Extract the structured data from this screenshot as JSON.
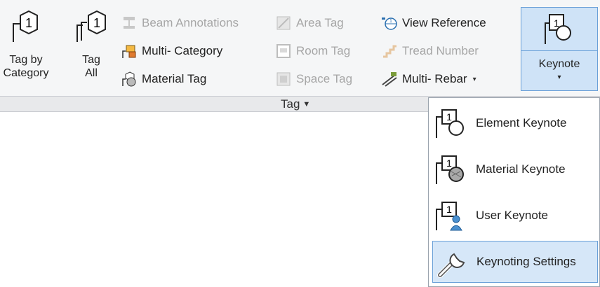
{
  "ribbon": {
    "tag_by_category": {
      "line1": "Tag by",
      "line2": "Category"
    },
    "tag_all": {
      "line1": "Tag",
      "line2": "All"
    },
    "col1": [
      {
        "label": "Beam  Annotations",
        "enabled": false,
        "icon": "beam-annotations-icon"
      },
      {
        "label": "Multi- Category",
        "enabled": true,
        "icon": "multi-category-icon"
      },
      {
        "label": "Material  Tag",
        "enabled": true,
        "icon": "material-tag-icon"
      }
    ],
    "col2": [
      {
        "label": "Area  Tag",
        "enabled": false,
        "icon": "area-tag-icon"
      },
      {
        "label": "Room  Tag",
        "enabled": false,
        "icon": "room-tag-icon"
      },
      {
        "label": "Space  Tag",
        "enabled": false,
        "icon": "space-tag-icon"
      }
    ],
    "col3": [
      {
        "label": "View  Reference",
        "enabled": true,
        "icon": "view-reference-icon"
      },
      {
        "label": "Tread  Number",
        "enabled": false,
        "icon": "tread-number-icon"
      },
      {
        "label": "Multi- Rebar",
        "enabled": true,
        "icon": "multi-rebar-icon",
        "caret": "▾"
      }
    ],
    "keynote": {
      "label": "Keynote",
      "caret": "▾"
    },
    "panel_title": "Tag",
    "panel_caret": "▼"
  },
  "keynote_menu": {
    "items": [
      {
        "label": "Element Keynote",
        "icon": "element-keynote-icon"
      },
      {
        "label": "Material Keynote",
        "icon": "material-keynote-icon"
      },
      {
        "label": "User Keynote",
        "icon": "user-keynote-icon"
      },
      {
        "label": "Keynoting Settings",
        "icon": "wrench-icon",
        "highlighted": true
      }
    ]
  },
  "colors": {
    "accent_fill": "#cfe3f7",
    "accent_border": "#6aa0d8",
    "disabled_text": "#a6a6a6"
  }
}
